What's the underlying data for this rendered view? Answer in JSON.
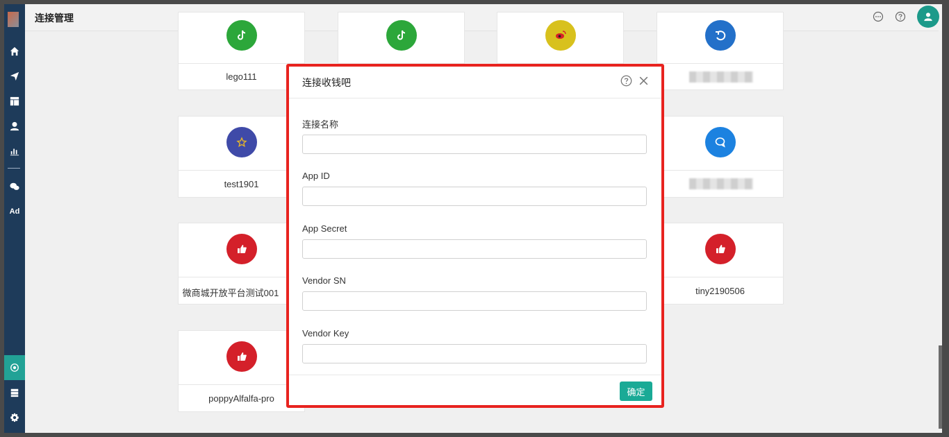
{
  "header": {
    "title": "连接管理",
    "icons": [
      "chat-icon",
      "help-icon",
      "user-avatar-icon"
    ]
  },
  "sidebar": {
    "items": [
      "home-icon",
      "send-icon",
      "layout-icon",
      "user-icon",
      "bar-chart-icon",
      "wechat-icon"
    ],
    "ad_label": "Ad",
    "bottom_items": [
      "hub-icon",
      "server-icon",
      "gear-icon"
    ],
    "active_item": "hub-icon"
  },
  "cards": [
    {
      "name": "lego111",
      "icon": "tiktok-icon",
      "color": "#2ca73a"
    },
    {
      "name": "",
      "icon": "tiktok-icon",
      "color": "#2ca73a"
    },
    {
      "name": "",
      "icon": "weibo-icon",
      "color": "#d8c11d"
    },
    {
      "name": "",
      "icon": "refresh-icon",
      "color": "#2370c9"
    },
    {
      "name": "test1901",
      "icon": "star-icon",
      "color": "#3f4aa8"
    },
    {
      "name": "",
      "icon": "chat-bubble-icon",
      "color": "#1c82e0"
    },
    {
      "name": "微商城开放平台测试001",
      "icon": "thumbs-up-icon",
      "color": "#d4202a"
    },
    {
      "name": "tiny2190506",
      "icon": "thumbs-up-icon",
      "color": "#d4202a"
    },
    {
      "name": "poppyAlfalfa-pro",
      "icon": "thumbs-up-icon",
      "color": "#d4202a"
    }
  ],
  "modal": {
    "title": "连接收钱吧",
    "fields": [
      {
        "label": "连接名称",
        "value": "",
        "placeholder": ""
      },
      {
        "label": "App ID",
        "value": "",
        "placeholder": ""
      },
      {
        "label": "App Secret",
        "value": "",
        "placeholder": ""
      },
      {
        "label": "Vendor SN",
        "value": "",
        "placeholder": ""
      },
      {
        "label": "Vendor Key",
        "value": "",
        "placeholder": ""
      }
    ],
    "confirm_label": "确定"
  },
  "colors": {
    "accent": "#1aaa96",
    "highlight_border": "#e8231f",
    "sidebar": "#1e3b5a"
  }
}
